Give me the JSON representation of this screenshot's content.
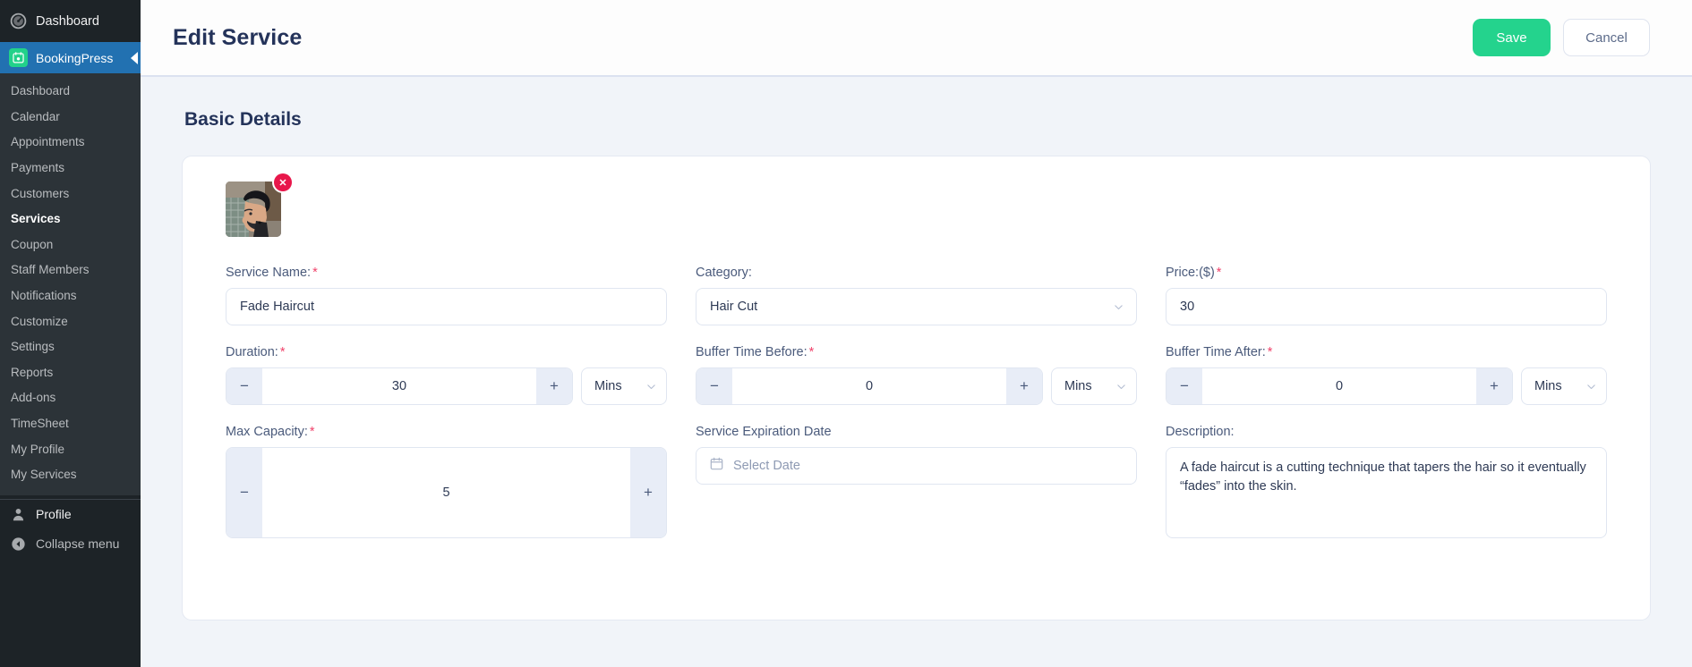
{
  "sidebar": {
    "dashboard_label": "Dashboard",
    "plugin_label": "BookingPress",
    "submenu": [
      {
        "label": "Dashboard",
        "current": false
      },
      {
        "label": "Calendar",
        "current": false
      },
      {
        "label": "Appointments",
        "current": false
      },
      {
        "label": "Payments",
        "current": false
      },
      {
        "label": "Customers",
        "current": false
      },
      {
        "label": "Services",
        "current": true
      },
      {
        "label": "Coupon",
        "current": false
      },
      {
        "label": "Staff Members",
        "current": false
      },
      {
        "label": "Notifications",
        "current": false
      },
      {
        "label": "Customize",
        "current": false
      },
      {
        "label": "Settings",
        "current": false
      },
      {
        "label": "Reports",
        "current": false
      },
      {
        "label": "Add-ons",
        "current": false
      },
      {
        "label": "TimeSheet",
        "current": false
      },
      {
        "label": "My Profile",
        "current": false
      },
      {
        "label": "My Services",
        "current": false
      }
    ],
    "profile_label": "Profile",
    "collapse_label": "Collapse menu"
  },
  "header": {
    "title": "Edit Service",
    "save_label": "Save",
    "cancel_label": "Cancel"
  },
  "section": {
    "title": "Basic Details"
  },
  "form": {
    "service_name": {
      "label": "Service Name:",
      "required": "*",
      "value": "Fade Haircut"
    },
    "category": {
      "label": "Category:",
      "value": "Hair Cut"
    },
    "price": {
      "label": "Price:($)",
      "required": "*",
      "value": "30"
    },
    "duration": {
      "label": "Duration:",
      "required": "*",
      "value": "30",
      "unit": "Mins",
      "minus": "−",
      "plus": "+"
    },
    "buffer_before": {
      "label": "Buffer Time Before:",
      "required": "*",
      "value": "0",
      "unit": "Mins",
      "minus": "−",
      "plus": "+"
    },
    "buffer_after": {
      "label": "Buffer Time After:",
      "required": "*",
      "value": "0",
      "unit": "Mins",
      "minus": "−",
      "plus": "+"
    },
    "max_capacity": {
      "label": "Max Capacity:",
      "required": "*",
      "value": "5",
      "minus": "−",
      "plus": "+"
    },
    "expiration_date": {
      "label": "Service Expiration Date",
      "placeholder": "Select Date",
      "value": ""
    },
    "description": {
      "label": "Description:",
      "value": "A fade haircut is a cutting technique that tapers the hair so it eventually “fades” into the skin."
    },
    "image": {
      "remove_label": "✕"
    }
  },
  "colors": {
    "accent_green": "#24d38d",
    "wp_blue": "#2271b1",
    "remove_red": "#e8174b",
    "required_red": "#f0436b",
    "heading": "#24335a",
    "page_bg": "#f1f4f9"
  }
}
